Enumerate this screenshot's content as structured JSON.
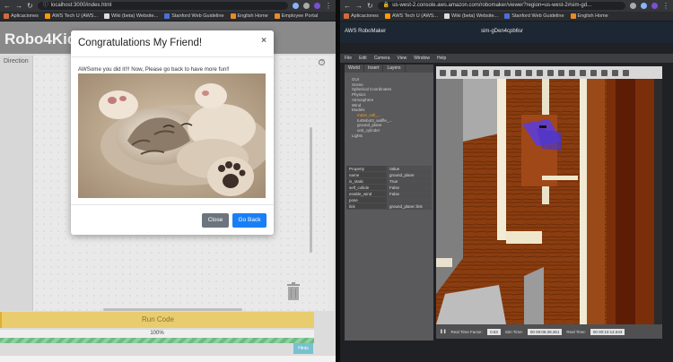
{
  "left_browser": {
    "url": "localhost:3000/index.html",
    "bookmarks": [
      "Aplicaciones",
      "AWS Tech U (AWS...",
      "Wiki (beta) Website...",
      "Stanford Web Guideline",
      "English Home",
      "Employee Portal"
    ]
  },
  "app": {
    "title": "Robo4Kids",
    "direction_label": "Direction",
    "help_glyph": "?",
    "run_button": "Run Code",
    "progress_text": "100%",
    "progress_value": 1.0,
    "hint_button": "Hints"
  },
  "modal": {
    "title": "Congratulations My Friend!",
    "close_glyph": "×",
    "message": "AWSome you did it!!! Now, Please go back to have more fun!!",
    "close_button": "Close",
    "go_back_button": "Go Back"
  },
  "right_browser": {
    "url": "us-west-2.console.aws.amazon.com/robomaker/viewer?region=us-west-2#sim-gd...",
    "bookmarks": [
      "Aplicaciones",
      "AWS Tech U (AWS...",
      "Wiki (beta) Website...",
      "Stanford Web Guideline",
      "English Home",
      "Employee Portal"
    ]
  },
  "robomaker": {
    "brand": "AWS RoboMaker",
    "sim_id": "sim-gDen4cpb6sr",
    "menu": [
      "File",
      "Edit",
      "Camera",
      "View",
      "Window",
      "Help"
    ],
    "tabs": [
      "World",
      "Insert",
      "Layers"
    ],
    "tree": [
      "GUI",
      "Scene",
      "Spherical Coordinates",
      "Physics",
      "Atmosphere",
      "Wind",
      "Models",
      "maze_cell_...",
      "turtlebot3_waffle_...",
      "ground_plane",
      "unit_cylinder",
      "Lights"
    ],
    "property_header": [
      "Property",
      "Value"
    ],
    "properties": [
      [
        "name",
        "ground_plane"
      ],
      [
        "is_static",
        "True"
      ],
      [
        "self_collide",
        "False"
      ],
      [
        "enable_wind",
        "False"
      ],
      [
        "pose",
        ""
      ],
      [
        "link",
        "ground_plane::link"
      ]
    ],
    "bottom": {
      "rtf_label": "Real Time Factor:",
      "rtf_value": "0.53",
      "sim_time_label": "Sim Time:",
      "sim_time_value": "00 00:05:28.361",
      "real_time_label": "Real Time:",
      "real_time_value": "00 00:10:14.643"
    }
  },
  "colors": {
    "run_button": "#e8cc6e",
    "progress": "#6dbb84",
    "go_back": "#1a7ff5",
    "close": "#6c757d"
  }
}
